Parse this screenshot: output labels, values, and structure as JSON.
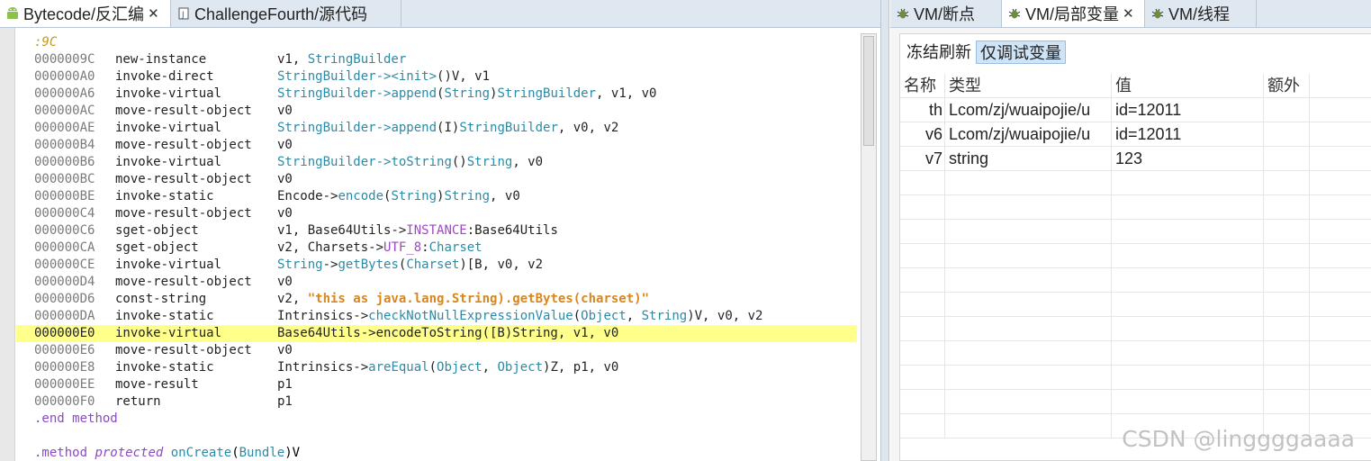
{
  "left_tabs": [
    {
      "label": "Bytecode/反汇编",
      "icon": "android-icon",
      "active": true
    },
    {
      "label": "ChallengeFourth/源代码",
      "icon": "java-file-icon",
      "active": false
    }
  ],
  "right_tabs": [
    {
      "label": "VM/断点",
      "icon": "bug-icon"
    },
    {
      "label": "VM/局部变量",
      "icon": "bug-icon",
      "active": true
    },
    {
      "label": "VM/线程",
      "icon": "bug-icon"
    }
  ],
  "code": {
    "label_line": ":9C",
    "rows": [
      {
        "addr": "0000009C",
        "op": "new-instance",
        "args": [
          {
            "t": "v1, "
          },
          {
            "t": "StringBuilder",
            "c": "teal"
          }
        ]
      },
      {
        "addr": "000000A0",
        "op": "invoke-direct",
        "args": [
          {
            "t": "StringBuilder->",
            "c": "teal"
          },
          {
            "t": "<init>",
            "c": "teal"
          },
          {
            "t": "()V, v1"
          }
        ]
      },
      {
        "addr": "000000A6",
        "op": "invoke-virtual",
        "args": [
          {
            "t": "StringBuilder->",
            "c": "teal"
          },
          {
            "t": "append",
            "c": "teal"
          },
          {
            "t": "("
          },
          {
            "t": "String",
            "c": "teal"
          },
          {
            "t": ")"
          },
          {
            "t": "StringBuilder",
            "c": "teal"
          },
          {
            "t": ", v1, v0"
          }
        ]
      },
      {
        "addr": "000000AC",
        "op": "move-result-object",
        "args": [
          {
            "t": "v0"
          }
        ]
      },
      {
        "addr": "000000AE",
        "op": "invoke-virtual",
        "args": [
          {
            "t": "StringBuilder->",
            "c": "teal"
          },
          {
            "t": "append",
            "c": "teal"
          },
          {
            "t": "(I)"
          },
          {
            "t": "StringBuilder",
            "c": "teal"
          },
          {
            "t": ", v0, v2"
          }
        ]
      },
      {
        "addr": "000000B4",
        "op": "move-result-object",
        "args": [
          {
            "t": "v0"
          }
        ]
      },
      {
        "addr": "000000B6",
        "op": "invoke-virtual",
        "args": [
          {
            "t": "StringBuilder->",
            "c": "teal"
          },
          {
            "t": "toString",
            "c": "teal"
          },
          {
            "t": "()"
          },
          {
            "t": "String",
            "c": "teal"
          },
          {
            "t": ", v0"
          }
        ]
      },
      {
        "addr": "000000BC",
        "op": "move-result-object",
        "args": [
          {
            "t": "v0"
          }
        ]
      },
      {
        "addr": "000000BE",
        "op": "invoke-static",
        "args": [
          {
            "t": "Encode->"
          },
          {
            "t": "encode",
            "c": "teal"
          },
          {
            "t": "("
          },
          {
            "t": "String",
            "c": "teal"
          },
          {
            "t": ")"
          },
          {
            "t": "String",
            "c": "teal"
          },
          {
            "t": ", v0"
          }
        ]
      },
      {
        "addr": "000000C4",
        "op": "move-result-object",
        "args": [
          {
            "t": "v0"
          }
        ]
      },
      {
        "addr": "000000C6",
        "op": "sget-object",
        "args": [
          {
            "t": "v1, Base64Utils->"
          },
          {
            "t": "INSTANCE",
            "c": "purple"
          },
          {
            "t": ":Base64Utils"
          }
        ]
      },
      {
        "addr": "000000CA",
        "op": "sget-object",
        "args": [
          {
            "t": "v2, Charsets->"
          },
          {
            "t": "UTF_8",
            "c": "purple"
          },
          {
            "t": ":"
          },
          {
            "t": "Charset",
            "c": "teal"
          }
        ]
      },
      {
        "addr": "000000CE",
        "op": "invoke-virtual",
        "args": [
          {
            "t": "String",
            "c": "teal"
          },
          {
            "t": "->"
          },
          {
            "t": "getBytes",
            "c": "teal"
          },
          {
            "t": "("
          },
          {
            "t": "Charset",
            "c": "teal"
          },
          {
            "t": ")[B, v0, v2"
          }
        ]
      },
      {
        "addr": "000000D4",
        "op": "move-result-object",
        "args": [
          {
            "t": "v0"
          }
        ]
      },
      {
        "addr": "000000D6",
        "op": "const-string",
        "args": [
          {
            "t": "v2, "
          },
          {
            "t": "\"this as java.lang.String).getBytes(charset)\"",
            "c": "orange"
          }
        ]
      },
      {
        "addr": "000000DA",
        "op": "invoke-static",
        "args": [
          {
            "t": "Intrinsics->"
          },
          {
            "t": "checkNotNullExpressionValue",
            "c": "teal"
          },
          {
            "t": "("
          },
          {
            "t": "Object",
            "c": "teal"
          },
          {
            "t": ", "
          },
          {
            "t": "String",
            "c": "teal"
          },
          {
            "t": ")V, v0, v2"
          }
        ]
      },
      {
        "addr": "000000E0",
        "op": "invoke-virtual",
        "args": [
          {
            "t": "Base64Utils->encodeToString([B)String, v1, v0"
          }
        ],
        "highlight": true,
        "breakpoint": true
      },
      {
        "addr": "000000E6",
        "op": "move-result-object",
        "args": [
          {
            "t": "v0"
          }
        ]
      },
      {
        "addr": "000000E8",
        "op": "invoke-static",
        "args": [
          {
            "t": "Intrinsics->"
          },
          {
            "t": "areEqual",
            "c": "teal"
          },
          {
            "t": "("
          },
          {
            "t": "Object",
            "c": "teal"
          },
          {
            "t": ", "
          },
          {
            "t": "Object",
            "c": "teal"
          },
          {
            "t": ")Z, p1, v0"
          }
        ]
      },
      {
        "addr": "000000EE",
        "op": "move-result",
        "args": [
          {
            "t": "p1"
          }
        ]
      },
      {
        "addr": "000000F0",
        "op": "return",
        "args": [
          {
            "t": "p1"
          }
        ]
      }
    ],
    "end_method": [
      {
        "t": ".end",
        "c": "kw"
      },
      {
        "t": " "
      },
      {
        "t": "method",
        "c": "kw"
      }
    ],
    "method_decl": [
      {
        "t": ".method",
        "c": "kw"
      },
      {
        "t": " "
      },
      {
        "t": "protected",
        "c": "kwi"
      },
      {
        "t": " "
      },
      {
        "t": "onCreate",
        "c": "teal"
      },
      {
        "t": "("
      },
      {
        "t": "Bundle",
        "c": "teal"
      },
      {
        "t": ")V"
      }
    ]
  },
  "locals": {
    "toolbar": {
      "freeze": "冻结刷新",
      "debug_only": "仅调试变量"
    },
    "headers": [
      "名称",
      "类型",
      "值",
      "额外"
    ],
    "rows": [
      {
        "name": "th",
        "type": "Lcom/zj/wuaipojie/u",
        "value": "id=12011",
        "extra": ""
      },
      {
        "name": "v6",
        "type": "Lcom/zj/wuaipojie/u",
        "value": "id=12011",
        "extra": ""
      },
      {
        "name": "v7",
        "type": "string",
        "value": "123",
        "extra": ""
      }
    ]
  },
  "watermark": "CSDN @linggggaaaa"
}
